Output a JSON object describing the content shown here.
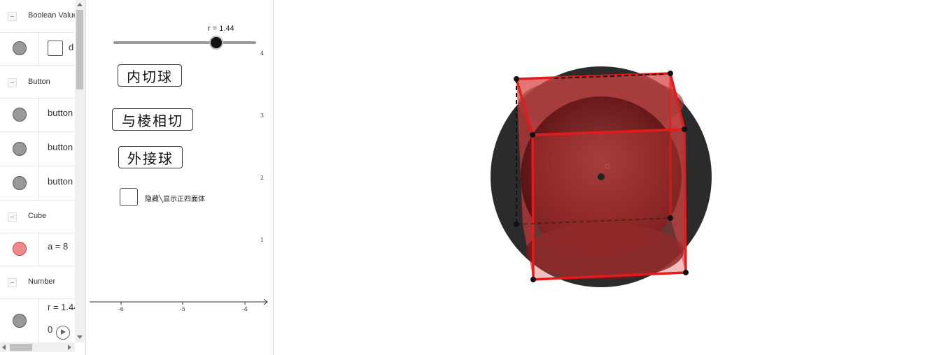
{
  "algebra": {
    "groups": [
      {
        "header": "Boolean Value",
        "items": [
          {
            "type": "checkbox",
            "text": "d"
          }
        ]
      },
      {
        "header": "Button",
        "items": [
          {
            "type": "text",
            "text": "button"
          },
          {
            "type": "text",
            "text": "button"
          },
          {
            "type": "text",
            "text": "button"
          }
        ]
      },
      {
        "header": "Cube",
        "items": [
          {
            "type": "text",
            "text": "a = 8",
            "marble": "red"
          }
        ]
      },
      {
        "header": "Number",
        "items": [
          {
            "type": "slider",
            "text": "r = 1.44",
            "min_label": "0"
          }
        ]
      }
    ]
  },
  "graphics1": {
    "slider": {
      "label": "r = 1.44",
      "value": 1.44,
      "fraction": 0.72
    },
    "buttons": [
      {
        "label": "内切球"
      },
      {
        "label": "与棱相切"
      },
      {
        "label": "外接球"
      }
    ],
    "checkbox": {
      "label": "隐藏╲显示正四面体",
      "checked": false
    },
    "x_ticks": [
      "-6",
      "-5",
      "-4"
    ],
    "y_ticks": [
      "4",
      "3",
      "2",
      "1"
    ]
  },
  "colors": {
    "cube_edge": "#e31b1b",
    "cube_face": "#e23a3a",
    "sphere_dark": "#2a2a2a",
    "inner_sphere": "#7a2020",
    "slider_knob": "#111111",
    "panel_border": "#d6d6d6"
  },
  "icons": {
    "collapse": "collapse-toggle-icon",
    "play": "play-icon"
  }
}
